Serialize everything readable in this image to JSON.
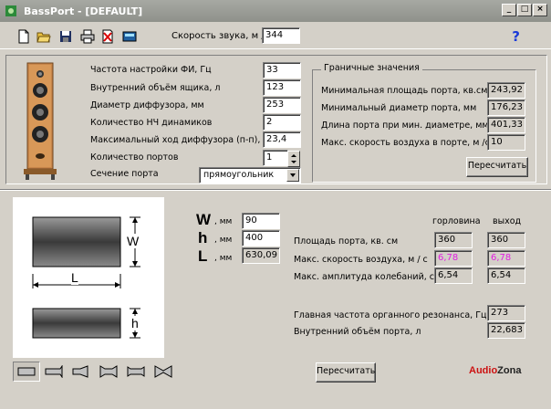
{
  "window": {
    "title": "BassPort - [DEFAULT]",
    "min": "_",
    "max": "□",
    "close": "×"
  },
  "toolbar": {
    "sound_speed_label": "Скорость звука, м /с",
    "sound_speed_value": "344",
    "help": "?",
    "icons": [
      "new-icon",
      "open-icon",
      "save-icon",
      "print-icon",
      "delete-icon",
      "calculator-icon"
    ]
  },
  "params": {
    "tuning_freq_label": "Частота настройки ФИ, Гц",
    "tuning_freq": "33",
    "volume_label": "Внутренний объём ящика, л",
    "volume": "123",
    "diaphragm_label": "Диаметр диффузора, мм",
    "diaphragm": "253",
    "drivers_label": "Количество НЧ динамиков",
    "drivers": "2",
    "xmax_label": "Максимальный ход диффузора (п-п), мм",
    "xmax": "23,4",
    "ports_label": "Количество портов",
    "ports": "1",
    "section_label": "Сечение порта",
    "section": "прямоугольник"
  },
  "limits": {
    "title": "Граничные значения",
    "min_area_label": "Минимальная площадь порта, кв.см.",
    "min_area": "243,92",
    "min_diam_label": "Минимальный диаметр порта, мм",
    "min_diam": "176,23",
    "length_label": "Длина порта при мин. диаметре, мм",
    "length": "401,33",
    "max_speed_label": "Макс. скорость воздуха в порте, м /с",
    "max_speed": "10",
    "recalc": "Пересчитать"
  },
  "diagram": {
    "w": "W",
    "h": "h",
    "l": "L"
  },
  "dims": {
    "w_letter": "W",
    "h_letter": "h",
    "l_letter": "L",
    "unit": ", мм",
    "w": "90",
    "h": "400",
    "l": "630,09"
  },
  "results": {
    "col_throat": "горловина",
    "col_exit": "выход",
    "area_label": "Площадь порта, кв. см",
    "area_throat": "360",
    "area_exit": "360",
    "speed_label": "Макс. скорость воздуха, м / с",
    "speed_throat": "6,78",
    "speed_exit": "6,78",
    "ampl_label": "Макс. амплитуда колебаний, см",
    "ampl_throat": "6,54",
    "ampl_exit": "6,54",
    "organ_label": "Главная частота органного резонанса, Гц",
    "organ": "273",
    "inner_vol_label": "Внутренний объём порта, л",
    "inner_vol": "22,683",
    "recalc": "Пересчитать"
  },
  "brand": {
    "audio": "Audio",
    "zona": "Zona",
    "audio_color": "#cc1111",
    "zona_color": "#222222"
  },
  "port_shapes": [
    "straight",
    "flare-one-side",
    "flare-exit",
    "double-flare",
    "narrow-ends",
    "bow-tie"
  ],
  "colors": {
    "face": "#d4d0c8",
    "speed_text": "#e020e0"
  }
}
